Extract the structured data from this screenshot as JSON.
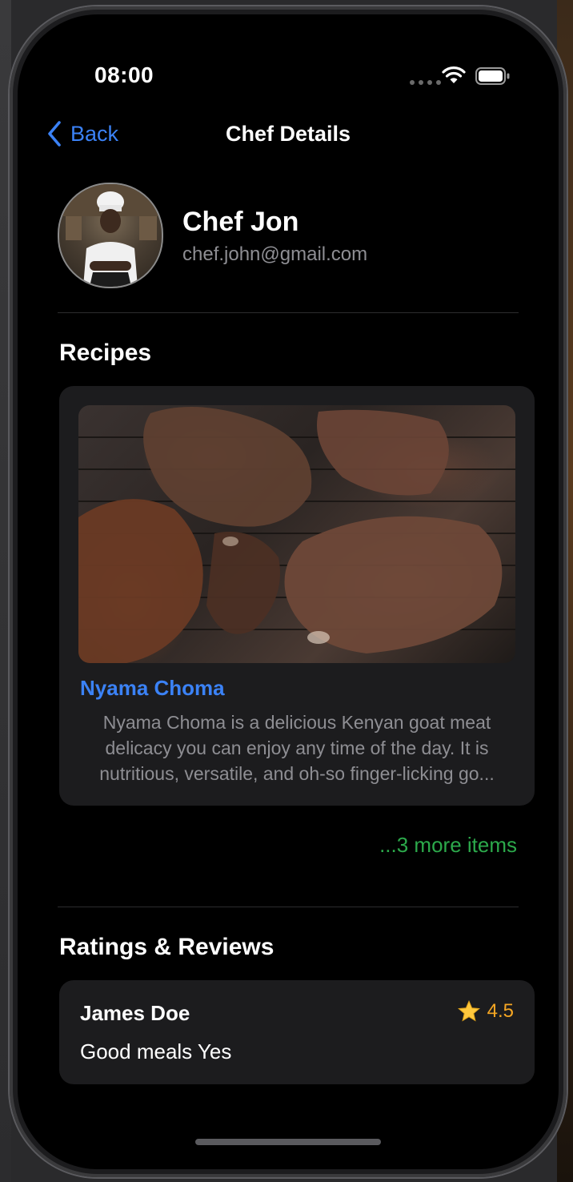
{
  "status_bar": {
    "time": "08:00"
  },
  "nav": {
    "back_label": "Back",
    "title": "Chef Details"
  },
  "profile": {
    "name": "Chef Jon",
    "email": "chef.john@gmail.com"
  },
  "recipes": {
    "section_title": "Recipes",
    "items": [
      {
        "name": "Nyama Choma",
        "description": "Nyama Choma is a delicious Kenyan goat meat delicacy you can enjoy any time of the day. It is nutritious, versatile, and oh-so finger-licking go..."
      }
    ],
    "more_label": "...3 more items"
  },
  "reviews": {
    "section_title": "Ratings & Reviews",
    "items": [
      {
        "reviewer": "James Doe",
        "rating": "4.5",
        "text": "Good meals Yes"
      }
    ]
  },
  "colors": {
    "accent_blue": "#3b82f6",
    "accent_green": "#34c759",
    "rating_orange": "#f5a623",
    "card_bg": "#1c1c1e",
    "background": "#000000"
  },
  "icons": [
    "chevron-left-icon",
    "wifi-icon",
    "battery-icon",
    "star-icon"
  ]
}
